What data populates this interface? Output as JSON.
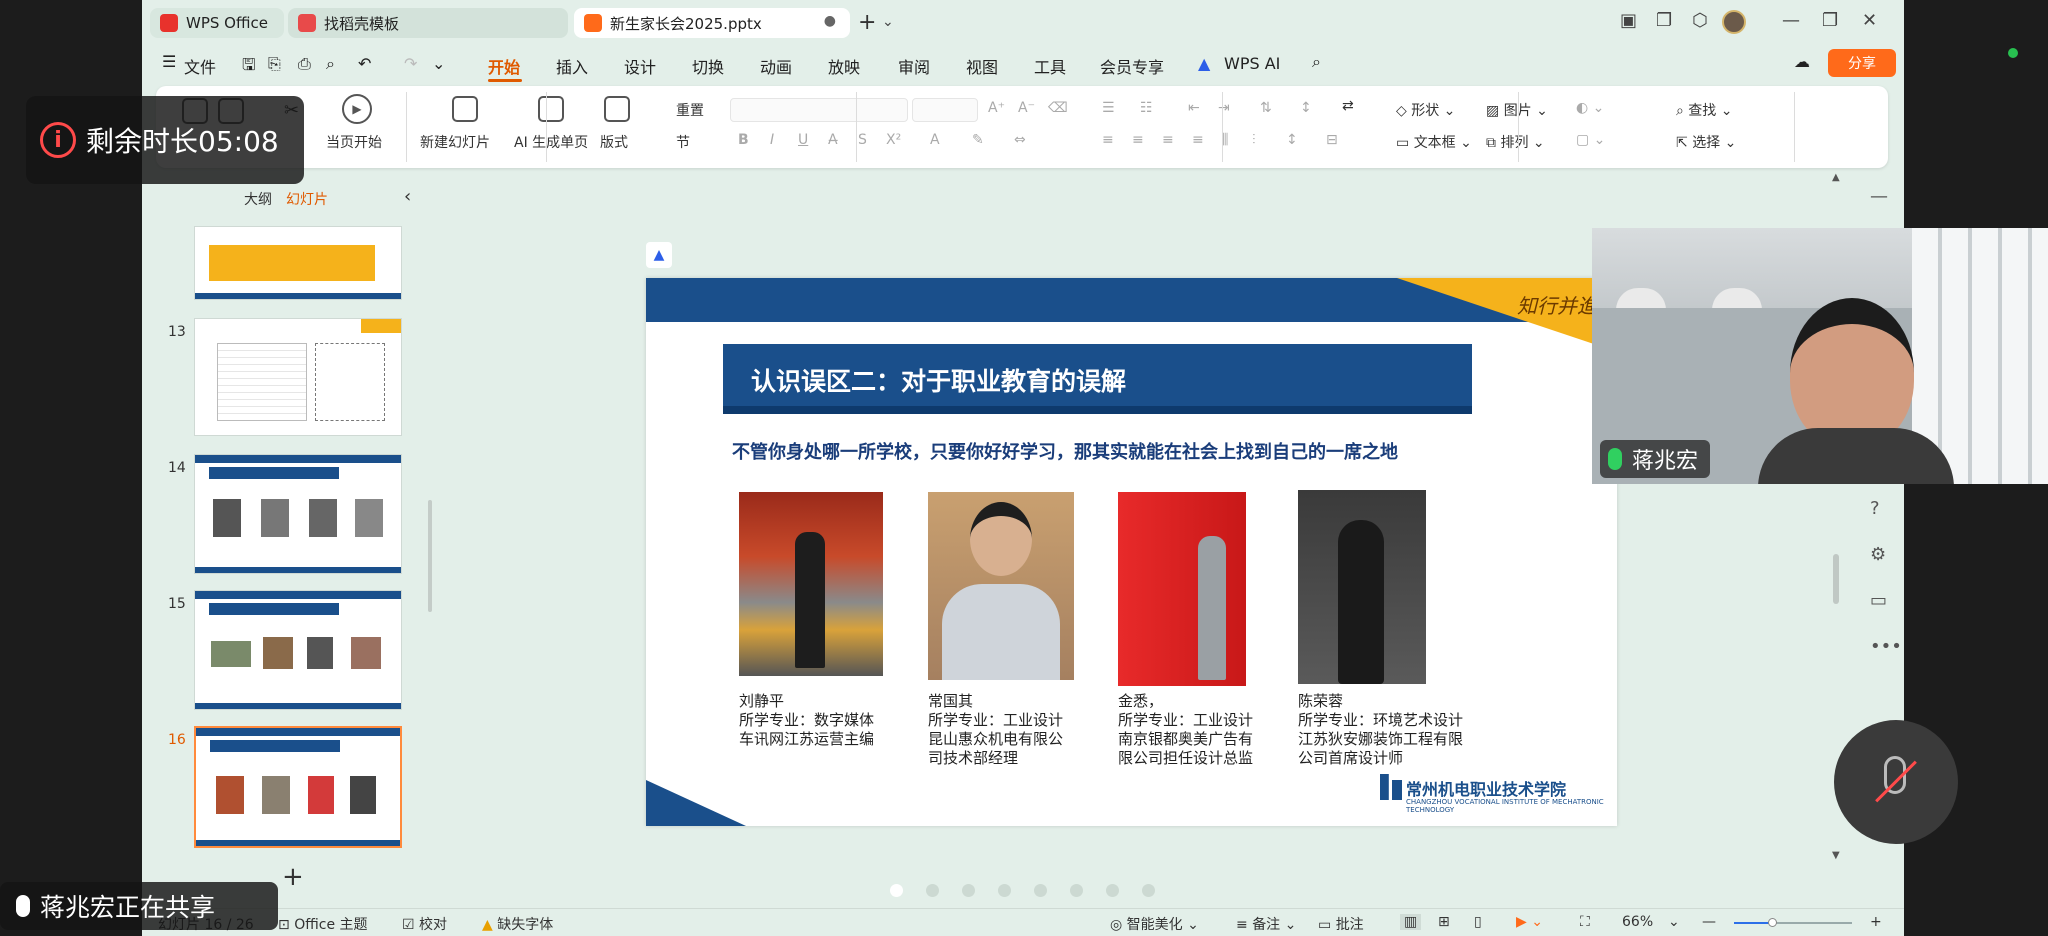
{
  "tabs": {
    "wps_office": "WPS Office",
    "template": "找稻壳模板",
    "document": "新生家长会2025.pptx"
  },
  "menu": {
    "file": "文件",
    "items": [
      "开始",
      "插入",
      "设计",
      "切换",
      "动画",
      "放映",
      "审阅",
      "视图",
      "工具",
      "会员专享",
      "WPS AI"
    ],
    "share": "分享"
  },
  "ribbon": {
    "play_from_current": "当页开始",
    "new_slide": "新建幻灯片",
    "ai_page": "AI 生成单页",
    "layout": "版式",
    "section": "节",
    "reset": "重置",
    "shape": "形状",
    "picture": "图片",
    "textbox": "文本框",
    "arrange": "排列",
    "find": "查找",
    "select": "选择"
  },
  "panel": {
    "outline_tab": "大纲",
    "slides_tab": "幻灯片",
    "thumb_numbers": [
      "13",
      "14",
      "15",
      "16"
    ]
  },
  "slide": {
    "motto": "知行并進",
    "title": "认识误区二：对于职业教育的误解",
    "subtitle": "不管你身处哪一所学校，只要你好好学习，那其实就能在社会上找到自己的一席之地",
    "people": [
      {
        "caption": "刘静平\n所学专业：数字媒体\n车讯网江苏运营主编"
      },
      {
        "caption": "常国其\n所学专业：工业设计\n昆山惠众机电有限公\n司技术部经理"
      },
      {
        "caption": "金悉，\n所学专业：工业设计\n南京银都奥美广告有\n限公司担任设计总监"
      },
      {
        "caption": "陈荣蓉\n所学专业：环境艺术设计\n江苏狄安娜装饰工程有限\n公司首席设计师"
      }
    ],
    "logo": "常州机电职业技术学院",
    "logo_sub": "CHANGZHOU VOCATIONAL INSTITUTE OF MECHATRONIC TECHNOLOGY"
  },
  "status": {
    "slide_counter": "幻灯片 16 / 26",
    "theme": "Office 主题",
    "proofread": "校对",
    "missing_font": "缺失字体",
    "beautify": "智能美化",
    "notes": "备注",
    "comments": "批注",
    "zoom": "66%"
  },
  "overlay": {
    "timer": "剩余时长05:08",
    "sharing": "蒋兆宏正在共享",
    "video_name": "蒋兆宏"
  },
  "colors": {
    "accent": "#e05a00",
    "slide_blue": "#1a4f8b",
    "slide_gold": "#f5b21b",
    "app_bg": "#e3efe9"
  }
}
